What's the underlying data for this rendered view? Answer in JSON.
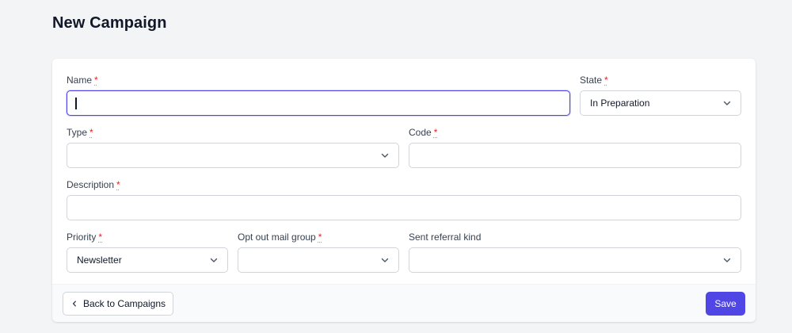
{
  "page": {
    "title": "New Campaign"
  },
  "form": {
    "required_mark": "*",
    "name": {
      "label": "Name",
      "value": ""
    },
    "state": {
      "label": "State",
      "value": "In Preparation"
    },
    "type": {
      "label": "Type",
      "value": ""
    },
    "code": {
      "label": "Code",
      "value": ""
    },
    "description": {
      "label": "Description",
      "value": ""
    },
    "priority": {
      "label": "Priority",
      "value": "Newsletter"
    },
    "opt_out_mail_group": {
      "label": "Opt out mail group",
      "value": ""
    },
    "sent_referral_kind": {
      "label": "Sent referral kind",
      "value": ""
    }
  },
  "footer": {
    "back_label": "Back to Campaigns",
    "save_label": "Save"
  },
  "colors": {
    "primary": "#4f46e5",
    "required": "#dc2626",
    "focus_border": "#4f46e5"
  },
  "icons": {
    "select": "chevron-down-icon",
    "back": "chevron-left-icon"
  }
}
